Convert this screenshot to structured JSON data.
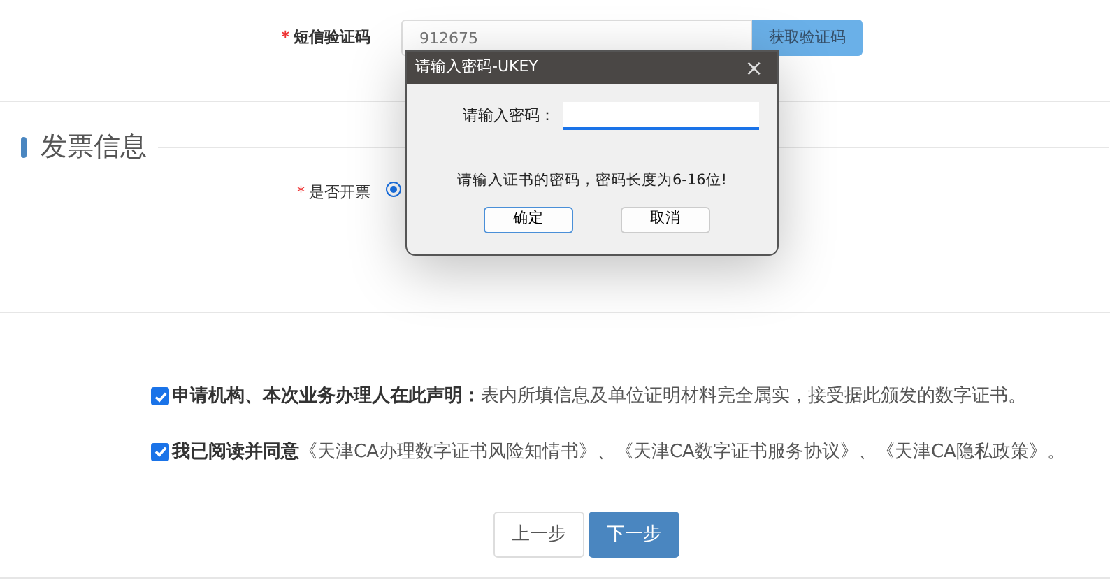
{
  "sms_code": {
    "required_mark": "*",
    "label": "短信验证码",
    "value": "912675",
    "button": "获取验证码"
  },
  "invoice_section": {
    "title": "发票信息"
  },
  "invoice_field": {
    "required_mark": "*",
    "label": "是否开票",
    "radio_selected": true
  },
  "declarations": [
    {
      "text": "**申请机构、本次业务办理人在此声明：**表内所填信息及单位证明材料完全属实，接受据此颁发的数字证书。",
      "checked": true
    },
    {
      "text": "**我已阅读并同意**《天津CA办理数字证书风险知情书》、《天津CA数字证书服务协议》、《天津CA隐私政策》。",
      "checked": true
    }
  ],
  "nav_buttons": [
    {
      "label": "上一步",
      "kind": "secondary"
    },
    {
      "label": "下一步",
      "kind": "primary"
    }
  ],
  "dialog": {
    "title": "请输入密码-UKEY",
    "close": "×",
    "field_label": "请输入密码：",
    "hint": "请输入证书的密码，密码长度为6-16位!",
    "ok": "确定",
    "cancel": "取消"
  }
}
